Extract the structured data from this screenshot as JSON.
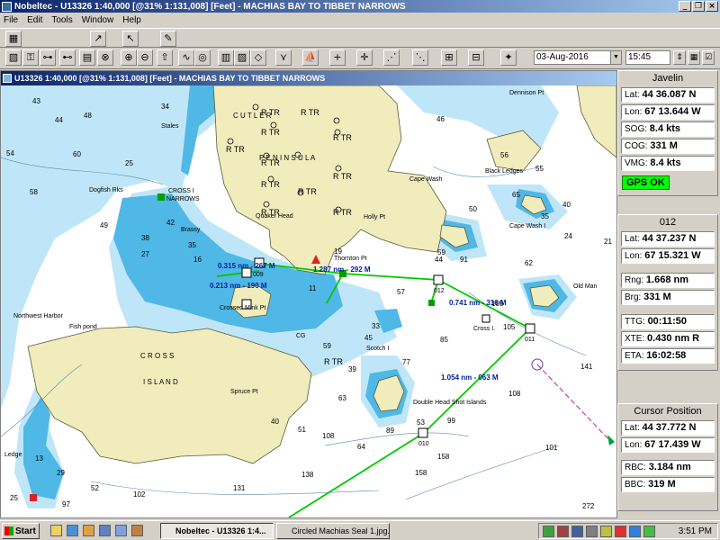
{
  "app": {
    "title": "Nobeltec - U13326 1:40,000 [@31% 1:131,008] [Feet] - MACHIAS BAY TO TIBBET NARROWS",
    "menus": [
      "File",
      "Edit",
      "Tools",
      "Window",
      "Help"
    ]
  },
  "toolbar": {
    "date": "03-Aug-2016",
    "time": "15:45"
  },
  "chart": {
    "title": "U13326 1:40,000 [@31% 1:131,008] [Feet] - MACHIAS BAY TO TIBBET NARROWS",
    "land_labels": [
      "C U T L E R",
      "P E N I N S U L A",
      "C R O S S",
      "I S L A N D",
      "CROSS I",
      "NARROWS"
    ],
    "place_labels": [
      "Stales",
      "Dogfish Rks",
      "Quaker Head",
      "Cape Wash",
      "Holly Pt",
      "Black Ledges",
      "Cape Wash I",
      "Thornton Pt",
      "Crossed Mink Pt",
      "Northwest Harbor",
      "Fish pond",
      "Scotch I",
      "Double Head Shot Islands",
      "Spruce Pt",
      "Old Man",
      "Dennison Pt",
      "Brassy",
      "Ledge",
      "CG",
      "Cross I."
    ],
    "rtr_labels": [
      "R TR",
      "R TR",
      "R TR",
      "R TR",
      "R TR",
      "R TR",
      "R TR",
      "R TR",
      "R TR",
      "R TR",
      "R TR",
      "R TR"
    ],
    "route_legs": [
      "0.315 nm - 267 M",
      "1.287 nm - 292 M",
      "0.213 nm - 190 M",
      "0.741 nm - 316 M",
      "1.054 nm - 063 M"
    ],
    "waypoints": [
      "009",
      "012",
      "011",
      "010"
    ],
    "soundings": [
      "43",
      "44",
      "48",
      "54",
      "34",
      "25",
      "60",
      "58",
      "49",
      "42",
      "35",
      "38",
      "27",
      "16",
      "11",
      "19",
      "59",
      "45",
      "39",
      "77",
      "57",
      "85",
      "44",
      "105",
      "141",
      "108",
      "101",
      "272",
      "158",
      "158",
      "102",
      "131",
      "138",
      "108",
      "89",
      "99",
      "91",
      "62",
      "40",
      "24",
      "21",
      "50",
      "64",
      "65",
      "56",
      "46",
      "55",
      "35",
      "29",
      "13",
      "53",
      "63",
      "25",
      "97",
      "52",
      "105",
      "51",
      "40",
      "59",
      "33"
    ]
  },
  "panels": {
    "vessel": {
      "name": "Javelin",
      "lat": "44 36.087 N",
      "lon": "67 13.644 W",
      "sog": "8.4 kts",
      "cog": "331 M",
      "vmg": "8.4 kts",
      "status": "GPS OK"
    },
    "waypoint": {
      "name": "012",
      "lat": "44 37.237 N",
      "lon": "67 15.321 W",
      "rng": "1.668 nm",
      "brg": "331 M",
      "ttg": "00:11:50",
      "xte": "0.430 nm R",
      "eta": "16:02:58"
    },
    "cursor": {
      "name": "Cursor Position",
      "lat": "44 37.772 N",
      "lon": "67 17.439 W",
      "rbc": "3.184 nm",
      "bbc": "319 M"
    }
  },
  "labels": {
    "lat": "Lat:",
    "lon": "Lon:",
    "sog": "SOG:",
    "cog": "COG:",
    "vmg": "VMG:",
    "rng": "Rng:",
    "brg": "Brg:",
    "ttg": "TTG:",
    "xte": "XTE:",
    "eta": "ETA:",
    "rbc": "RBC:",
    "bbc": "BBC:"
  },
  "taskbar": {
    "start": "Start",
    "tasks": [
      "Nobeltec - U13326 1:4...",
      "Circled Machias Seal 1.jpg..."
    ],
    "clock": "3:51 PM"
  },
  "colors": {
    "land": "#f1ecbc",
    "shallow_dark": "#48b8e8",
    "shallow_light": "#b8e4f8",
    "route": "#00c800",
    "track": "#c040c0",
    "label_blue": "#0020a0"
  }
}
